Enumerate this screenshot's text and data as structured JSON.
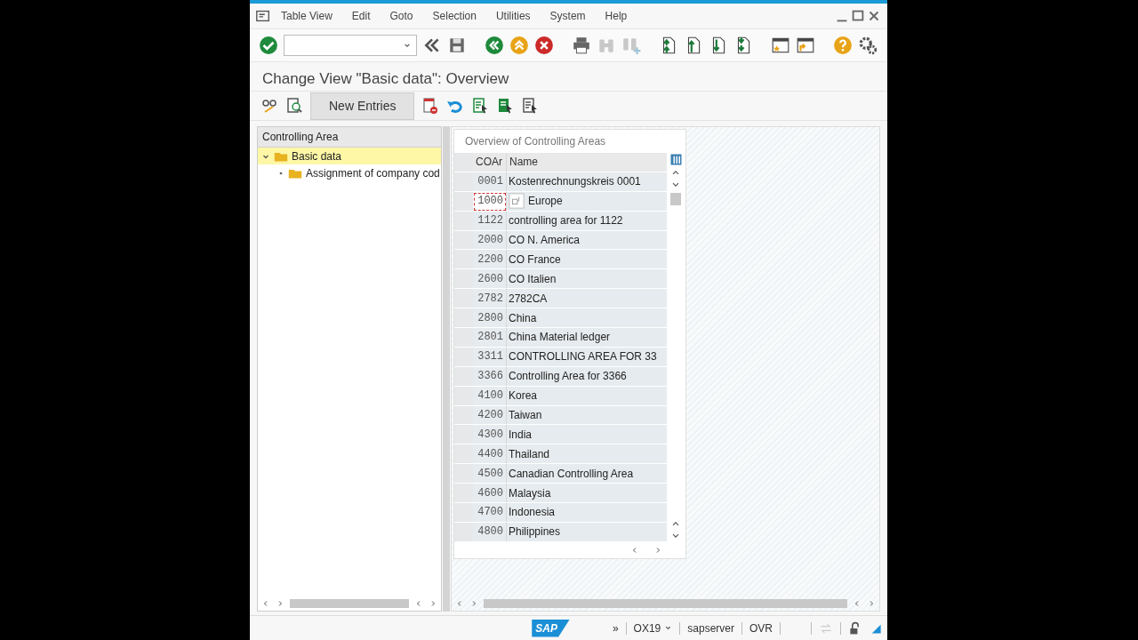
{
  "menu": [
    "Table View",
    "Edit",
    "Goto",
    "Selection",
    "Utilities",
    "System",
    "Help"
  ],
  "title": "Change View \"Basic data\": Overview",
  "app_toolbar": {
    "button": "New Entries"
  },
  "tree": {
    "header": "Controlling Area",
    "items": [
      {
        "label": "Basic data",
        "selected": true,
        "expanded": true,
        "children": [
          {
            "label": "Assignment of company cod",
            "selected": false
          }
        ]
      }
    ]
  },
  "table": {
    "title": "Overview of Controlling Areas",
    "columns": [
      "COAr",
      "Name"
    ],
    "rows": [
      {
        "code": "0001",
        "name": "Kostenrechnungskreis 0001",
        "focused": false
      },
      {
        "code": "1000",
        "name": "Europe",
        "focused": true
      },
      {
        "code": "1122",
        "name": "controlling area for 1122",
        "focused": false
      },
      {
        "code": "2000",
        "name": "CO N. America",
        "focused": false
      },
      {
        "code": "2200",
        "name": "CO France",
        "focused": false
      },
      {
        "code": "2600",
        "name": "CO Italien",
        "focused": false
      },
      {
        "code": "2782",
        "name": "2782CA",
        "focused": false
      },
      {
        "code": "2800",
        "name": "China",
        "focused": false
      },
      {
        "code": "2801",
        "name": "China Material ledger",
        "focused": false
      },
      {
        "code": "3311",
        "name": "CONTROLLING AREA FOR 33",
        "focused": false
      },
      {
        "code": "3366",
        "name": "Controlling Area for 3366",
        "focused": false
      },
      {
        "code": "4100",
        "name": "Korea",
        "focused": false
      },
      {
        "code": "4200",
        "name": "Taiwan",
        "focused": false
      },
      {
        "code": "4300",
        "name": "India",
        "focused": false
      },
      {
        "code": "4400",
        "name": "Thailand",
        "focused": false
      },
      {
        "code": "4500",
        "name": "Canadian Controlling Area",
        "focused": false
      },
      {
        "code": "4600",
        "name": "Malaysia",
        "focused": false
      },
      {
        "code": "4700",
        "name": "Indonesia",
        "focused": false
      },
      {
        "code": "4800",
        "name": "Philippines",
        "focused": false
      }
    ]
  },
  "status_bar": {
    "logo": "SAP",
    "expand": "»",
    "transaction": "OX19",
    "server": "sapserver",
    "mode": "OVR"
  }
}
